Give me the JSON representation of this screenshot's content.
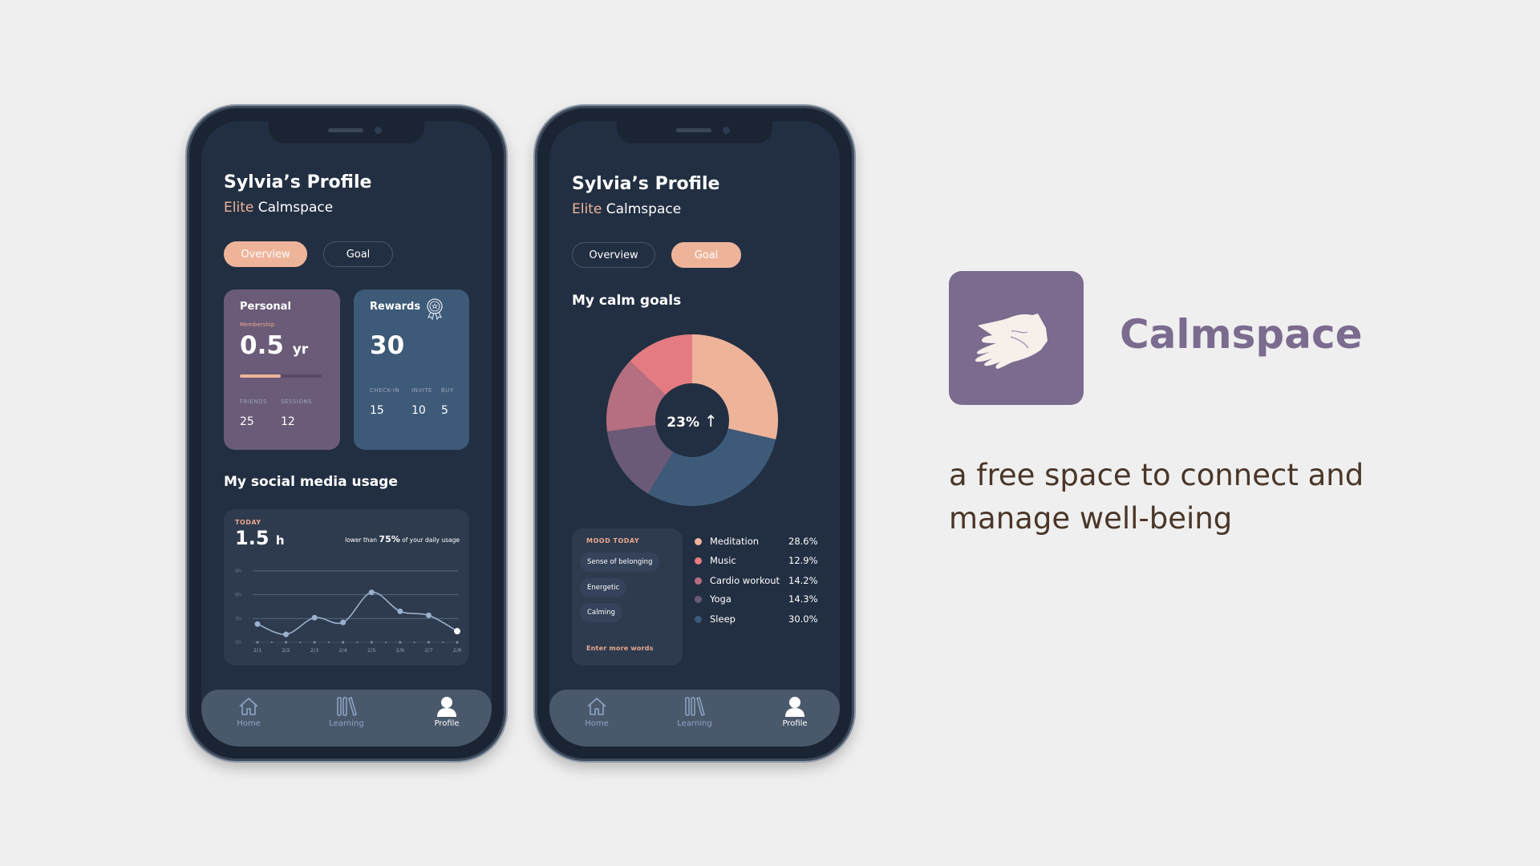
{
  "profile": {
    "title": "Sylvia’s Profile",
    "tier": "Elite",
    "brand": "Calmspace"
  },
  "tabs": {
    "overview": "Overview",
    "goal": "Goal"
  },
  "personal": {
    "title": "Personal",
    "membership_label": "Membership",
    "membership_value": "0.5",
    "membership_unit": "yr",
    "membership_progress": 0.5,
    "friends_label": "FRIENDS",
    "friends": "25",
    "sessions_label": "SESSIONS",
    "sessions": "12"
  },
  "rewards": {
    "title": "Rewards",
    "icon": "award-ribbon-icon",
    "total": "30",
    "checkin_label": "CHECK-IN",
    "checkin": "15",
    "invite_label": "INVITE",
    "invite": "10",
    "buy_label": "BUY",
    "buy": "5"
  },
  "usage": {
    "title": "My social media usage",
    "today_label": "TODAY",
    "today_value": "1.5",
    "today_unit": "h",
    "compare_pre": "lower than",
    "compare_pct": "75%",
    "compare_post": "of your daily usage"
  },
  "goals": {
    "title": "My calm goals",
    "center": "23%",
    "center_icon": "arrow-up-icon",
    "mood_title": "MOOD TODAY",
    "moods": [
      "Sense of belonging",
      "Energetic",
      "Calming"
    ],
    "enter_more": "Enter more words"
  },
  "nav": {
    "home": "Home",
    "learning": "Learning",
    "profile": "Profile"
  },
  "brand_panel": {
    "name": "Calmspace",
    "tagline_1": "a free space to connect and",
    "tagline_2": "manage well-being",
    "logo_icon": "open-hand-icon"
  },
  "colors": {
    "background": "#efefef",
    "screen": "#222f42",
    "accent": "#eeb49a",
    "brand": "#7b6b8f",
    "tagline": "#4a3628"
  },
  "chart_data": [
    {
      "type": "line",
      "categories": [
        "2/1",
        "2/2",
        "2/3",
        "2/4",
        "2/5",
        "2/6",
        "2/7",
        "2/8"
      ],
      "values": [
        2.3,
        1.0,
        3.1,
        2.5,
        6.3,
        3.9,
        3.4,
        1.4
      ],
      "ylim": [
        0,
        9
      ],
      "yticks": [
        "0h",
        "3h",
        "6h",
        "9h"
      ],
      "grid": true
    },
    {
      "type": "pie",
      "donut": true,
      "series": [
        {
          "name": "Meditation",
          "value": 28.6,
          "label": "28.6%",
          "color": "#eeb49a"
        },
        {
          "name": "Sleep",
          "value": 30.0,
          "label": "30.0%",
          "color": "#3d5a78"
        },
        {
          "name": "Yoga",
          "value": 14.3,
          "label": "14.3%",
          "color": "#6a5a78"
        },
        {
          "name": "Cardio workout",
          "value": 14.2,
          "label": "14.2%",
          "color": "#b56f80"
        },
        {
          "name": "Music",
          "value": 12.9,
          "label": "12.9%",
          "color": "#e57b82"
        }
      ],
      "legend_order": [
        0,
        4,
        3,
        2,
        1
      ]
    }
  ]
}
